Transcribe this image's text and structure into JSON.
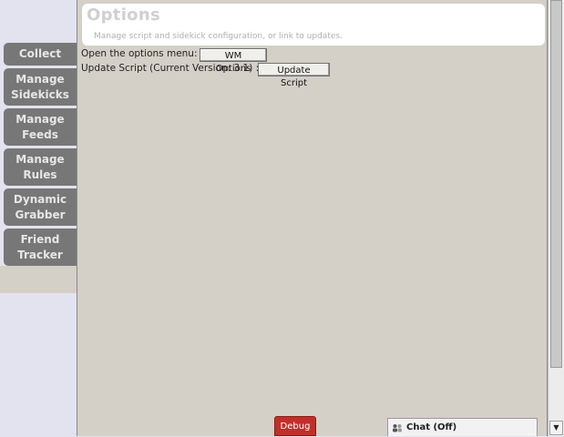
{
  "header": {
    "title": "Options",
    "subtitle": "Manage script and sidekick configuration, or link to updates."
  },
  "options": {
    "menu_label": "Open the options menu:",
    "menu_button": "WM Options",
    "update_label": "Update Script (Current Version: 3.1) :",
    "update_button": "Update Script"
  },
  "tabs": [
    {
      "line1": "Collect",
      "line2": ""
    },
    {
      "line1": "Manage",
      "line2": "Sidekicks"
    },
    {
      "line1": "Manage",
      "line2": "Feeds"
    },
    {
      "line1": "Manage",
      "line2": "Rules"
    },
    {
      "line1": "Dynamic",
      "line2": "Grabber"
    },
    {
      "line1": "Friend",
      "line2": "Tracker"
    }
  ],
  "footer": {
    "debug_label": "Debug",
    "chat_label": "Chat (Off)"
  },
  "icons": {
    "chat": "chat-people-icon",
    "scroll_down": "scroll-down-arrow-icon"
  },
  "colors": {
    "tab_bg": "#777777",
    "panel_bg": "#d4d0c8",
    "debug_bg": "#c0302b"
  }
}
